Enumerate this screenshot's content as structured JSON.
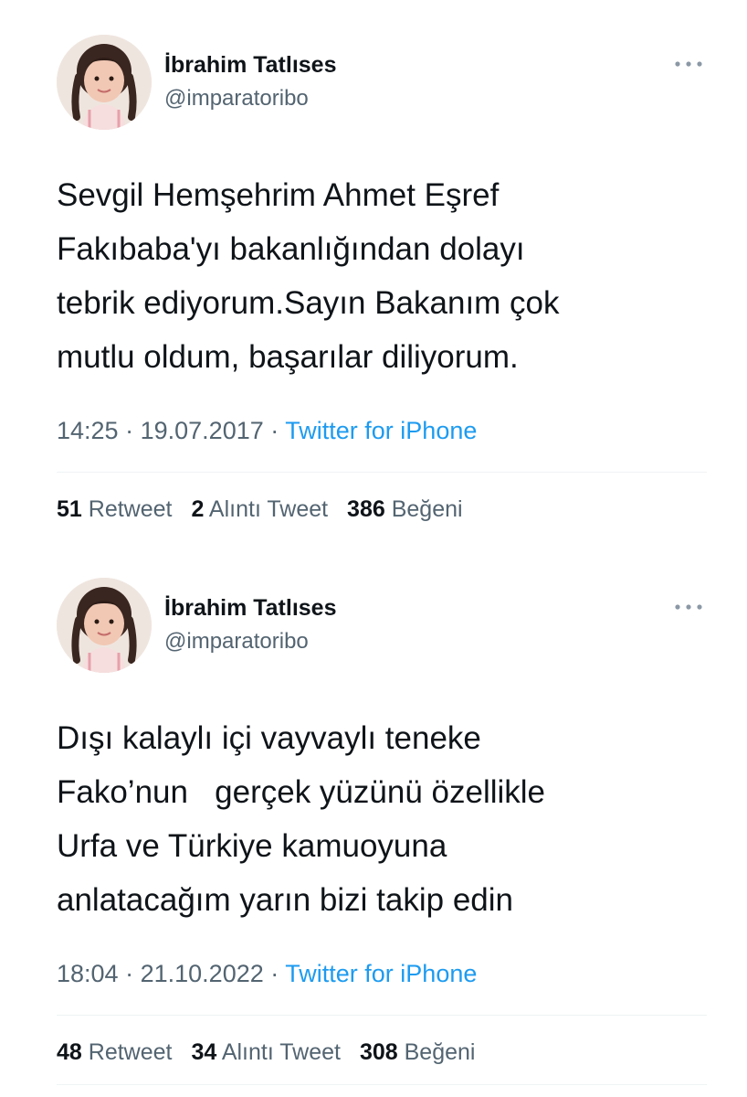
{
  "colors": {
    "text": "#0f1419",
    "secondary": "#536471",
    "link": "#1d9bf0",
    "divider": "#eff3f4"
  },
  "tweets": [
    {
      "author_name": "İbrahim Tatlıses",
      "author_handle": "@imparatoribo",
      "text_lines": [
        "Sevgil Hemşehrim Ahmet Eşref",
        "Fakıbaba'yı bakanlığından dolayı",
        "tebrik ediyorum.Sayın Bakanım çok",
        "mutlu oldum, başarılar diliyorum."
      ],
      "time": "14:25",
      "date": "19.07.2017",
      "separator": "·",
      "source": "Twitter for iPhone",
      "retweets": {
        "count": "51",
        "label": "Retweet"
      },
      "quotes": {
        "count": "2",
        "label": "Alıntı Tweet"
      },
      "likes": {
        "count": "386",
        "label": "Beğeni"
      }
    },
    {
      "author_name": "İbrahim Tatlıses",
      "author_handle": "@imparatoribo",
      "text_lines": [
        "Dışı kalaylı içi vayvaylı teneke",
        "Fako’nun   gerçek yüzünü özellikle",
        "Urfa ve Türkiye kamuoyuna",
        "anlatacağım yarın bizi takip edin"
      ],
      "time": "18:04",
      "date": "21.10.2022",
      "separator": "·",
      "source": "Twitter for iPhone",
      "retweets": {
        "count": "48",
        "label": "Retweet"
      },
      "quotes": {
        "count": "34",
        "label": "Alıntı Tweet"
      },
      "likes": {
        "count": "308",
        "label": "Beğeni"
      }
    }
  ]
}
